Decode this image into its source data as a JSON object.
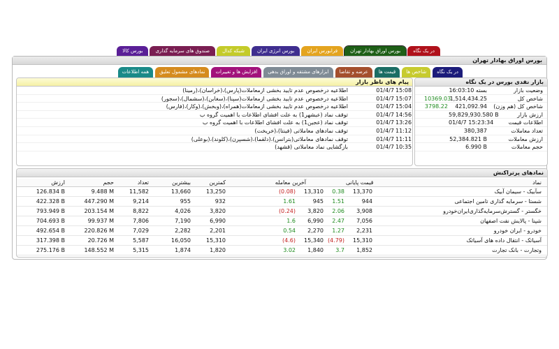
{
  "top_tabs": [
    {
      "label": "در یک نگاه",
      "color": "#b0111b"
    },
    {
      "label": "بورس اوراق بهادار تهران",
      "color": "#1e5f17",
      "active": true
    },
    {
      "label": "فرابورس ایران",
      "color": "#e4a41f"
    },
    {
      "label": "بورس انرژی ایران",
      "color": "#3f2e8f"
    },
    {
      "label": "شبکه کدال",
      "color": "#c4cb2a"
    },
    {
      "label": "صندوق های سرمایه گذاری",
      "color": "#7a1e52"
    },
    {
      "label": "بورس کالا",
      "color": "#5a1f97"
    }
  ],
  "page_title": "بورس اوراق بهادار تهران",
  "sub_tabs": [
    {
      "label": "در یک نگاه",
      "color": "#1c1c7a",
      "active": true
    },
    {
      "label": "شاخص ها",
      "color": "#c7cb2f"
    },
    {
      "label": "قیمت ها",
      "color": "#1b6d64"
    },
    {
      "label": "عرضه و تقاضا",
      "color": "#a44f2d"
    },
    {
      "label": "ابزارهای مشتقه و اوراق بدهی",
      "color": "#7f8b95"
    },
    {
      "label": "افزایش ها و تغییرات",
      "color": "#a2127b"
    },
    {
      "label": "نمادهای مشمول تعلیق",
      "color": "#d58b1e"
    },
    {
      "label": "همه اطلاعات",
      "color": "#1a8a88"
    }
  ],
  "messages_panel": {
    "title": "پیام های ناظر بازار",
    "rows": [
      {
        "date": "01/4/7",
        "time": "15:08",
        "text": "اطلاعیه درخصوص عدم تایید بخشی ازمعاملات(پارس)،(خراسان)،(رمینا)"
      },
      {
        "date": "01/4/7",
        "time": "15:07",
        "text": "اطلاعیه درخصوص عدم تایید بخشی ازمعاملات(سپنا)،(سغابن)،(سشمال)،(سجور)"
      },
      {
        "date": "01/4/7",
        "time": "15:04",
        "text": "اطلاعیه درخصوص عدم تایید بخشی ازمعاملات(همراه)،(وبخش)،(وکار)،(فارس)"
      },
      {
        "date": "01/4/7",
        "time": "14:56",
        "text": "توقف نماد (عبشهر1) به علت افشای اطلاعات با اهمیت گروه ب"
      },
      {
        "date": "01/4/7",
        "time": "13:26",
        "text": "توقف نماد (عجین1) به علت افشای اطلاعات با اهمیت گروه ب"
      },
      {
        "date": "01/4/7",
        "time": "11:12",
        "text": "توقف نمادهای معاملاتی (فینتا)،(خریخت)"
      },
      {
        "date": "01/4/7",
        "time": "11:11",
        "text": "توقف نمادهای معاملاتی(بترانس)،(دلقما)،(شسپرن)،(کلوند)،(بوعلی)"
      },
      {
        "date": "01/4/7",
        "time": "10:35",
        "text": "بازگشایی نماد معاملاتی (قشهد)"
      }
    ]
  },
  "market_panel": {
    "title": "بازار نقدی بورس در یک نگاه",
    "rows": [
      {
        "label": "وضعیت بازار",
        "value": "بسته 16:03:10",
        "extra": ""
      },
      {
        "label": "شاخص کل",
        "value": "1,514,434.25",
        "extra": "10369.03"
      },
      {
        "label": "شاخص کل (هم وزن)",
        "value": "421,092.94",
        "extra": "3798.22"
      },
      {
        "label": "ارزش بازار",
        "value": "59,829,930.580 B",
        "extra": ""
      },
      {
        "label": "اطلاعات قیمت",
        "value": "01/4/7 15:23:34",
        "extra": ""
      },
      {
        "label": "تعداد معاملات",
        "value": "380,387",
        "extra": ""
      },
      {
        "label": "ارزش معاملات",
        "value": "52,384.821 B",
        "extra": ""
      },
      {
        "label": "حجم معاملات",
        "value": "6.990 B",
        "extra": ""
      }
    ]
  },
  "trades_panel": {
    "title": "نمادهای پرتراکنش",
    "headers": {
      "symbol": "نماد",
      "close": "قیمت پایانی",
      "last": "آخرین معامله",
      "low": "کمترین",
      "high": "بیشترین",
      "count": "تعداد",
      "volume": "حجم",
      "value": "ارزش"
    },
    "rows": [
      {
        "symbol": "سآبیک - سیمان آبیک",
        "close": "13,370",
        "close_change": "0.38",
        "last": "13,310",
        "last_change": "(0.08)",
        "low": "13,250",
        "high": "13,660",
        "count": "11,582",
        "volume": "9.488 M",
        "value": "126.834 B",
        "close_color": "green",
        "last_color": "red"
      },
      {
        "symbol": "شستا - سرمایه گذاری تامین اجتماعی",
        "close": "944",
        "close_change": "1.51",
        "last": "945",
        "last_change": "1.61",
        "low": "932",
        "high": "955",
        "count": "9,214",
        "volume": "447.290 M",
        "value": "422.328 B",
        "close_color": "green",
        "last_color": "green"
      },
      {
        "symbol": "خگستر - گسترش‌سرمایه‌گذاری‌ایران‌خودرو",
        "close": "3,908",
        "close_change": "2.06",
        "last": "3,820",
        "last_change": "(0.24)",
        "low": "3,820",
        "high": "4,026",
        "count": "8,822",
        "volume": "203.154 M",
        "value": "793.949 B",
        "close_color": "green",
        "last_color": "red"
      },
      {
        "symbol": "شپنا - پالایش نفت اصفهان",
        "close": "7,056",
        "close_change": "2.47",
        "last": "6,990",
        "last_change": "1.6",
        "low": "6,990",
        "high": "7,190",
        "count": "7,806",
        "volume": "99.937 M",
        "value": "704.693 B",
        "close_color": "green",
        "last_color": "green"
      },
      {
        "symbol": "خودرو - ایران‌ خودرو",
        "close": "2,231",
        "close_change": "1.27",
        "last": "2,270",
        "last_change": "0.54",
        "low": "2,201",
        "high": "2,282",
        "count": "7,029",
        "volume": "220.826 M",
        "value": "492.654 B",
        "close_color": "green",
        "last_color": "green"
      },
      {
        "symbol": "آسیاتک - انتقال داده های آسیاتک",
        "close": "15,310",
        "close_change": "(4.79)",
        "last": "15,340",
        "last_change": "(4.6)",
        "low": "15,310",
        "high": "16,050",
        "count": "5,587",
        "volume": "20.726 M",
        "value": "317.398 B",
        "close_color": "red",
        "last_color": "red"
      },
      {
        "symbol": "وتجارت - بانک تجارت",
        "close": "1,852",
        "close_change": "3.7",
        "last": "1,840",
        "last_change": "3.02",
        "low": "1,820",
        "high": "1,874",
        "count": "5,315",
        "volume": "148.552 M",
        "value": "275.176 B",
        "close_color": "green",
        "last_color": "green"
      }
    ]
  }
}
